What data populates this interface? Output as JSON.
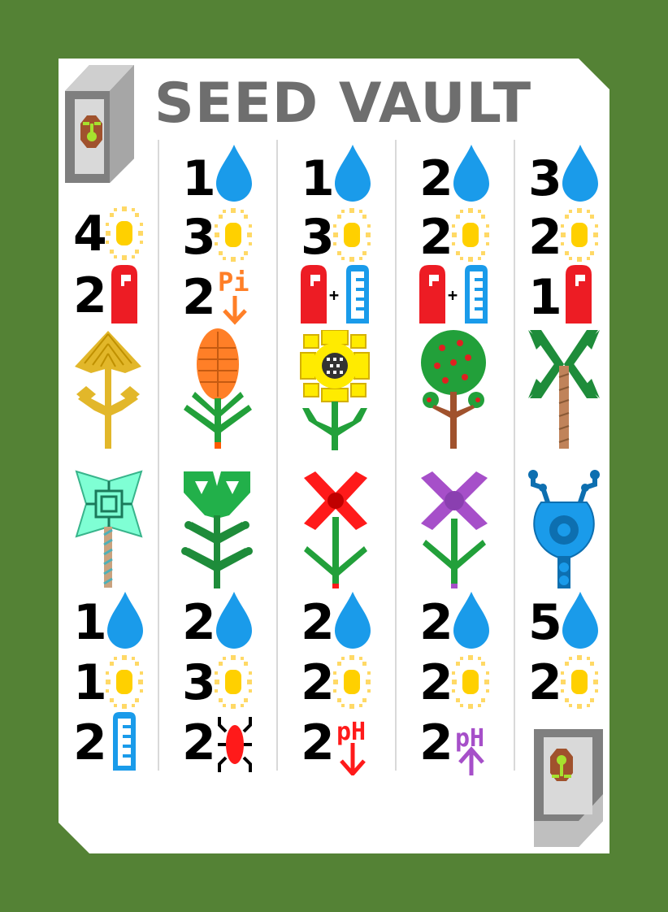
{
  "card": {
    "title": "SEED VAULT",
    "background_color": "#548235",
    "card_color": "#ffffff",
    "title_color": "#6e6e6e",
    "corner_icons": [
      "seed-packet-icon",
      "seed-packet-icon"
    ],
    "columns": [
      {
        "top_plant": "golden-tree-icon",
        "top_requirements": [
          {
            "value": "4",
            "icon": "sun-icon"
          },
          {
            "value": "2",
            "icon": "fertilizer-can-icon"
          }
        ],
        "bottom_plant": "crystal-tree-icon",
        "bottom_requirements": [
          {
            "value": "1",
            "icon": "water-drop-icon"
          },
          {
            "value": "1",
            "icon": "sun-icon"
          },
          {
            "value": "2",
            "icon": "ruler-icon"
          }
        ]
      },
      {
        "top_plant": "orange-banksia-icon",
        "top_requirements": [
          {
            "value": "1",
            "icon": "water-drop-icon"
          },
          {
            "value": "3",
            "icon": "sun-icon"
          },
          {
            "value": "2",
            "icon": "pi-arrow-down-icon"
          }
        ],
        "bottom_plant": "green-fern-icon",
        "bottom_requirements": [
          {
            "value": "2",
            "icon": "water-drop-icon"
          },
          {
            "value": "3",
            "icon": "sun-icon"
          },
          {
            "value": "2",
            "icon": "bug-icon"
          }
        ]
      },
      {
        "top_plant": "sunflower-icon",
        "top_requirements": [
          {
            "value": "1",
            "icon": "water-drop-icon"
          },
          {
            "value": "3",
            "icon": "sun-icon"
          },
          {
            "value": "",
            "icon": "fertilizer-plus-ruler-icon"
          }
        ],
        "bottom_plant": "red-flower-icon",
        "bottom_requirements": [
          {
            "value": "2",
            "icon": "water-drop-icon"
          },
          {
            "value": "2",
            "icon": "sun-icon"
          },
          {
            "value": "2",
            "icon": "ph-down-icon"
          }
        ]
      },
      {
        "top_plant": "apple-tree-icon",
        "top_requirements": [
          {
            "value": "2",
            "icon": "water-drop-icon"
          },
          {
            "value": "2",
            "icon": "sun-icon"
          },
          {
            "value": "",
            "icon": "fertilizer-plus-ruler-icon"
          }
        ],
        "bottom_plant": "purple-flower-icon",
        "bottom_requirements": [
          {
            "value": "2",
            "icon": "water-drop-icon"
          },
          {
            "value": "2",
            "icon": "sun-icon"
          },
          {
            "value": "2",
            "icon": "ph-up-icon"
          }
        ]
      },
      {
        "top_plant": "palm-tree-icon",
        "top_requirements": [
          {
            "value": "3",
            "icon": "water-drop-icon"
          },
          {
            "value": "2",
            "icon": "sun-icon"
          },
          {
            "value": "1",
            "icon": "fertilizer-can-icon"
          }
        ],
        "bottom_plant": "blue-alien-plant-icon",
        "bottom_requirements": [
          {
            "value": "5",
            "icon": "water-drop-icon"
          },
          {
            "value": "2",
            "icon": "sun-icon"
          }
        ]
      }
    ]
  },
  "pi_label": "Pi",
  "ph_label": "pH",
  "plus_label": "+"
}
